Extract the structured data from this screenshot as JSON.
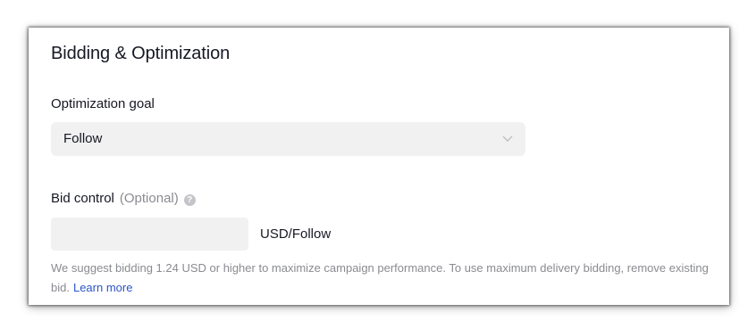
{
  "section": {
    "title": "Bidding & Optimization"
  },
  "optimization_goal": {
    "label": "Optimization goal",
    "selected": "Follow"
  },
  "bid_control": {
    "label": "Bid control",
    "optional": "(Optional)",
    "help_glyph": "?",
    "input_value": "",
    "unit": "USD/Follow",
    "hint": "We suggest bidding 1.24 USD or higher to maximize campaign performance. To use maximum delivery bidding, remove existing bid.",
    "learn_more": "Learn more"
  },
  "colors": {
    "text": "#161823",
    "muted": "#8a8b91",
    "field_bg": "#f1f1f2",
    "link": "#2a55c9"
  },
  "icons": {
    "dropdown": "chevron-down-icon",
    "help": "question-circle-icon"
  }
}
